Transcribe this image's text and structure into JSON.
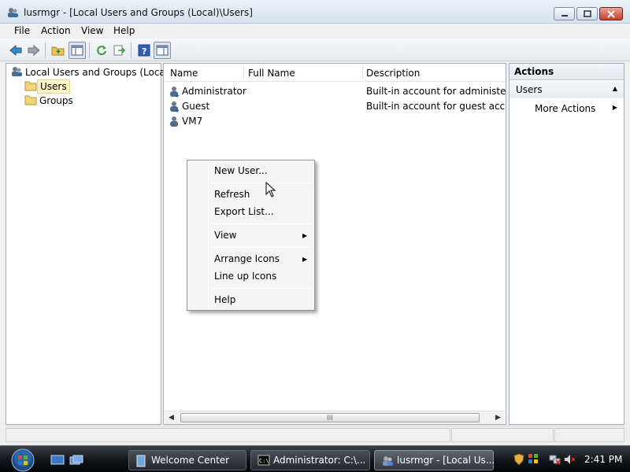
{
  "window": {
    "title": "lusrmgr - [Local Users and Groups (Local)\\Users]"
  },
  "menubar": {
    "items": [
      "File",
      "Action",
      "View",
      "Help"
    ]
  },
  "toolbar": {
    "buttons": [
      "back-icon",
      "forward-icon",
      "up-folder-icon",
      "show-hide-tree-icon",
      "refresh-icon",
      "export-list-icon",
      "help-icon",
      "show-hide-action-pane-icon"
    ]
  },
  "tree": {
    "root": "Local Users and Groups (Local)",
    "children": [
      "Users",
      "Groups"
    ],
    "selected": "Users"
  },
  "list": {
    "columns": [
      "Name",
      "Full Name",
      "Description"
    ],
    "rows": [
      {
        "name": "Administrator",
        "full_name": "",
        "description": "Built-in account for administering"
      },
      {
        "name": "Guest",
        "full_name": "",
        "description": "Built-in account for guest access t"
      },
      {
        "name": "VM7",
        "full_name": "",
        "description": ""
      }
    ],
    "scroll_grip": "III"
  },
  "actions": {
    "title": "Actions",
    "section": "Users",
    "item": "More Actions"
  },
  "context_menu": {
    "items": [
      {
        "label": "New User...",
        "submenu": false
      },
      {
        "label": "Refresh",
        "submenu": false
      },
      {
        "label": "Export List...",
        "submenu": false
      },
      {
        "label": "View",
        "submenu": true
      },
      {
        "label": "Arrange Icons",
        "submenu": true
      },
      {
        "label": "Line up Icons",
        "submenu": false
      },
      {
        "label": "Help",
        "submenu": false
      }
    ]
  },
  "taskbar": {
    "tasks": [
      {
        "label": "Welcome Center",
        "active": false
      },
      {
        "label": "Administrator: C:\\...",
        "active": false
      },
      {
        "label": "lusrmgr - [Local Us...",
        "active": true
      }
    ],
    "clock": "2:41 PM"
  },
  "colors": {
    "selection": "#fff3c8",
    "taskbar": "#111418",
    "accent": "#2f6db5"
  }
}
